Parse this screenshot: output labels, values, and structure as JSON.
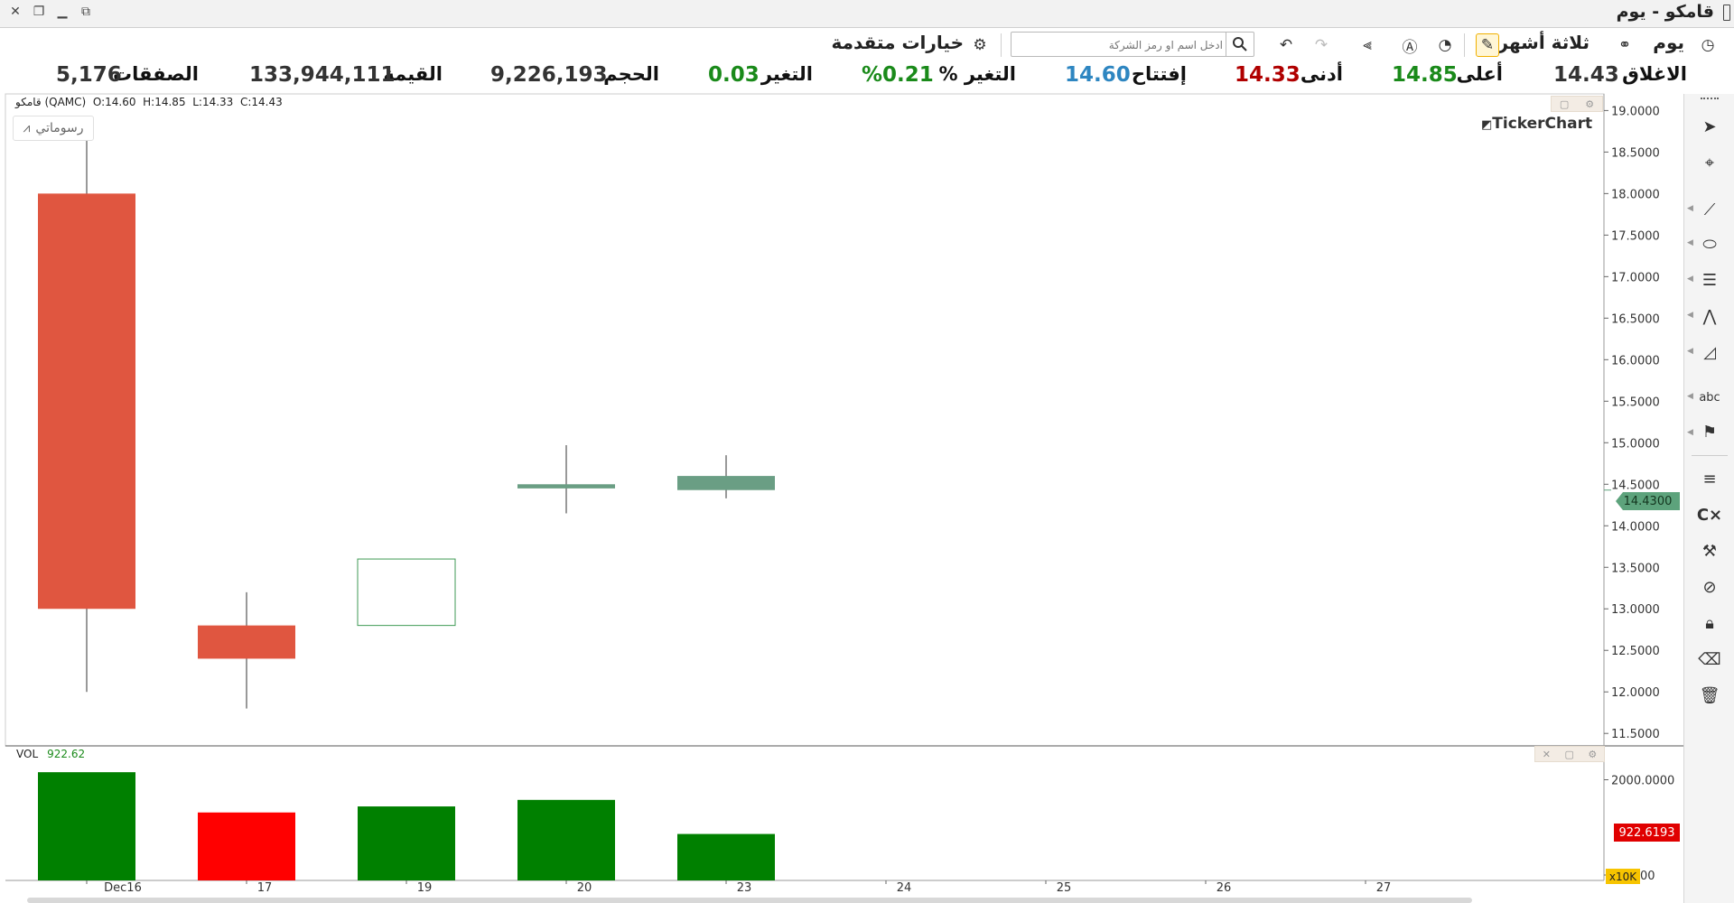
{
  "window": {
    "title": "قامكو - يوم"
  },
  "toolbar": {
    "period": "يوم",
    "range": "ثلاثة أشهر",
    "advanced_options": "خيارات متقدمة",
    "search_placeholder": "ادخل اسم او رمز الشركة",
    "icons": [
      "clock-icon",
      "link-icon",
      "draw-tool-icon",
      "gauge-icon",
      "auto-icon",
      "indicators-icon",
      "redo-icon",
      "undo-icon",
      "search-icon",
      "settings-icon"
    ]
  },
  "stats": {
    "close_label": "الاغلاق",
    "close_value": "14.43",
    "high_label": "أعلى",
    "high_value": "14.85",
    "low_label": "أدنى",
    "low_value": "14.33",
    "open_label": "إفتتاح",
    "open_value": "14.60",
    "change_pct_label": "التغير %",
    "change_pct_value": "%0.21",
    "change_label": "التغير",
    "change_value": "0.03",
    "volume_label": "الحجم",
    "volume_value": "9,226,193",
    "value_label": "القيمة",
    "value_value": "133,944,111",
    "trades_label": "الصفقات",
    "trades_value": "5,176"
  },
  "legend": {
    "symbol": "قامكو (QAMC)",
    "open": "O:14.60",
    "high": "H:14.85",
    "low": "L:14.33",
    "close": "C:14.43",
    "drawings_button": "رسوماتي",
    "watermark": "TickerChart",
    "last_price_tag": "14.4300",
    "volume_label": "VOL",
    "volume_value": "922.62",
    "volume_tag": "922.6193",
    "volume_multiplier": "x10K"
  },
  "colors": {
    "down": "#e05640",
    "up_candle": "#6a9e84",
    "up_hollow_border": "#3f9a55",
    "vol_up": "#008000",
    "vol_down": "#ff0000",
    "change_positive": "#1a8a1a",
    "open_blue": "#2e86c1",
    "low_red": "#b00000"
  },
  "chart_data": [
    {
      "type": "candlestick",
      "x": [
        "Dec16",
        "17",
        "19",
        "20",
        "23",
        "24",
        "25",
        "26",
        "27"
      ],
      "candles": [
        {
          "x": "Dec16",
          "open": 18.0,
          "high": 18.9,
          "low": 12.0,
          "close": 13.0,
          "fill": "down"
        },
        {
          "x": "17",
          "open": 12.8,
          "high": 13.2,
          "low": 11.8,
          "close": 12.4,
          "fill": "down"
        },
        {
          "x": "19",
          "open": 12.8,
          "high": 13.6,
          "low": 12.8,
          "close": 13.6,
          "fill": "hollow"
        },
        {
          "x": "20",
          "open": 14.45,
          "high": 14.97,
          "low": 14.15,
          "close": 14.5,
          "fill": "up"
        },
        {
          "x": "23",
          "open": 14.6,
          "high": 14.85,
          "low": 14.33,
          "close": 14.43,
          "fill": "up"
        }
      ],
      "ylim": [
        11.35,
        19.2
      ],
      "y_ticks": [
        "19.0000",
        "18.5000",
        "18.0000",
        "17.5000",
        "17.0000",
        "16.5000",
        "16.0000",
        "15.5000",
        "15.0000",
        "14.5000",
        "14.0000",
        "13.5000",
        "13.0000",
        "12.5000",
        "12.0000",
        "11.5000"
      ],
      "grid": false
    },
    {
      "type": "bar",
      "name": "VOL",
      "categories": [
        "Dec16",
        "17",
        "19",
        "20",
        "23"
      ],
      "values": [
        2150,
        1350,
        1470,
        1600,
        922.62
      ],
      "colors": [
        "up",
        "down",
        "up",
        "up",
        "up"
      ],
      "ylim": [
        0,
        2350
      ],
      "y_ticks": [
        "2000.0000",
        "00"
      ],
      "unit": "x10K"
    }
  ]
}
